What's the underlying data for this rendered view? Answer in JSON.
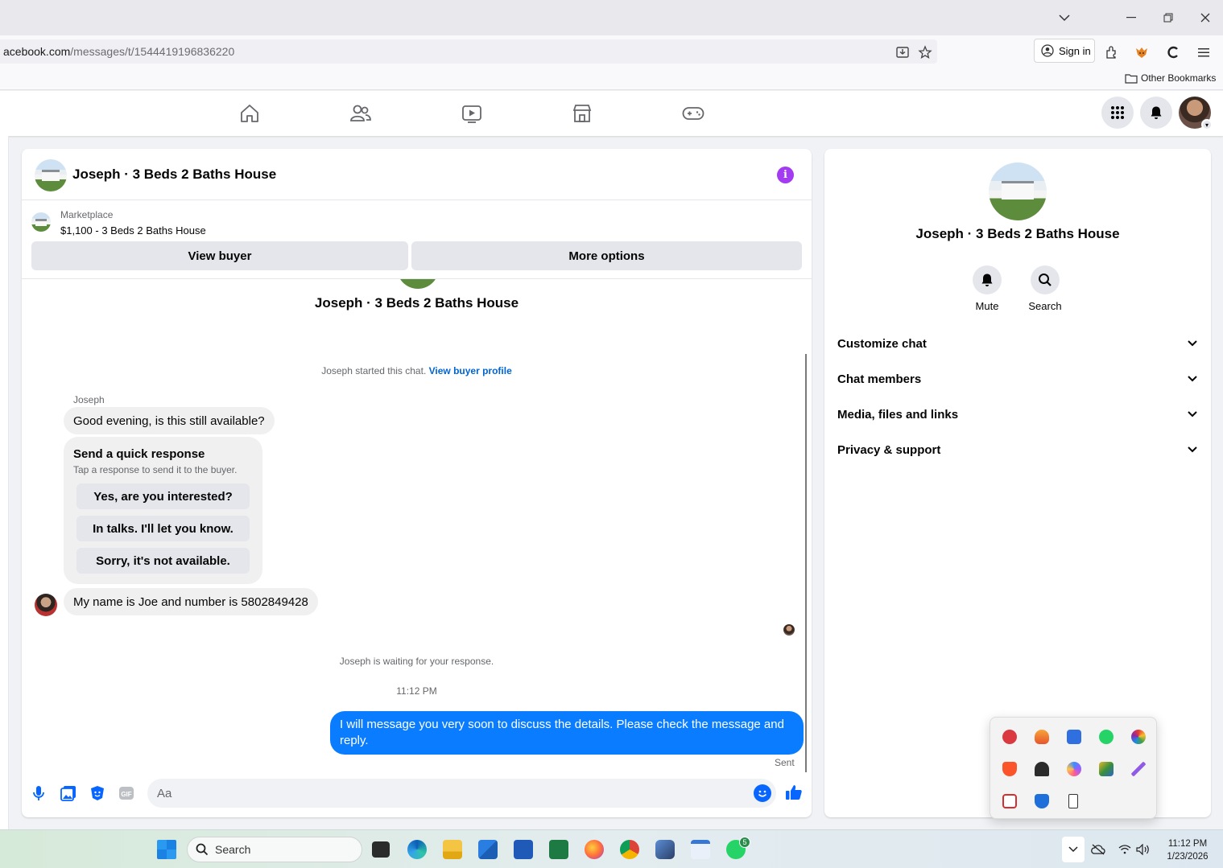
{
  "browser": {
    "url_domain": "acebook.com",
    "url_path": "/messages/t/1544419196836220",
    "sign_in_label": "Sign in",
    "other_bookmarks_label": "Other Bookmarks"
  },
  "chat": {
    "title": "Joseph · 3 Beds 2 Baths House",
    "marketplace_label": "Marketplace",
    "listing": "$1,100 - 3 Beds 2 Baths House",
    "view_buyer_label": "View buyer",
    "more_options_label": "More options",
    "thread_title": "Joseph · 3 Beds 2 Baths House",
    "started_text": "Joseph started this chat.",
    "view_profile_link": "View buyer profile",
    "sender_name": "Joseph",
    "message_1": "Good evening, is this still available?",
    "quick_title": "Send a quick response",
    "quick_subtitle": "Tap a response to send it to the buyer.",
    "quick_responses": [
      "Yes, are you interested?",
      "In talks. I'll let you know.",
      "Sorry, it's not available."
    ],
    "message_2": "My name is Joe and number is 5802849428",
    "waiting_text": "Joseph is waiting for your response.",
    "timestamp": "11:12 PM",
    "outgoing_message": "I will message you very soon to discuss the details. Please check the message and reply.",
    "sent_label": "Sent",
    "composer_placeholder": "Aa"
  },
  "info_panel": {
    "name": "Joseph · 3 Beds 2 Baths House",
    "mute_label": "Mute",
    "search_label": "Search",
    "sections": [
      "Customize chat",
      "Chat members",
      "Media, files and links",
      "Privacy & support"
    ]
  },
  "taskbar": {
    "search_label": "Search",
    "whatsapp_badge": "5",
    "time": "11:12 PM",
    "date": "1/23/2026"
  },
  "colors": {
    "accent": "#0a7cff",
    "link": "#0064d1",
    "info": "#a33bf2"
  }
}
